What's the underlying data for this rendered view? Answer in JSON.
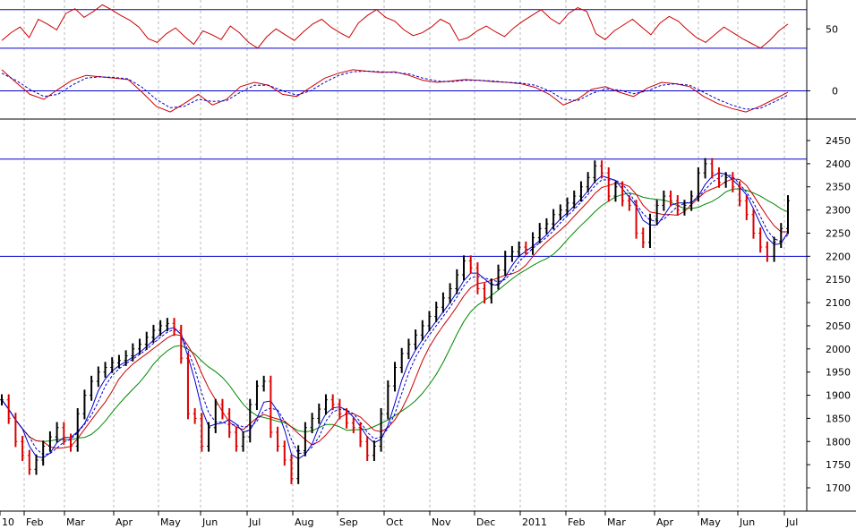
{
  "chart_data": [
    {
      "type": "line",
      "panel": "upper-oscillator",
      "y_ticks": [
        "50"
      ],
      "reference_levels": [
        70,
        30
      ],
      "points": [
        38,
        46,
        52,
        41,
        60,
        55,
        49,
        66,
        71,
        62,
        68,
        75,
        70,
        64,
        59,
        52,
        40,
        36,
        45,
        51,
        42,
        34,
        48,
        44,
        39,
        53,
        46,
        36,
        30,
        42,
        50,
        44,
        38,
        47,
        55,
        60,
        52,
        46,
        41,
        56,
        64,
        70,
        62,
        58,
        49,
        43,
        46,
        52,
        60,
        55,
        38,
        41,
        48,
        53,
        47,
        42,
        51,
        58,
        64,
        70,
        61,
        55,
        66,
        72,
        68,
        45,
        39,
        48,
        54,
        60,
        52,
        44,
        56,
        63,
        58,
        49,
        41,
        36,
        44,
        52,
        46,
        40,
        35,
        30,
        38,
        48,
        55
      ]
    },
    {
      "type": "line",
      "panel": "middle-oscillator",
      "y_ticks": [
        "0"
      ],
      "reference_levels": [
        0
      ],
      "series": [
        {
          "name": "",
          "style": "solid",
          "color": "#cc0000",
          "values": [
            30,
            12,
            -5,
            -12,
            2,
            15,
            22,
            20,
            18,
            16,
            -2,
            -22,
            -30,
            -18,
            -5,
            -20,
            -12,
            6,
            12,
            8,
            -5,
            -8,
            5,
            18,
            25,
            30,
            28,
            26,
            27,
            22,
            15,
            12,
            14,
            16,
            15,
            13,
            12,
            10,
            5,
            -5,
            -20,
            -12,
            2,
            6,
            -2,
            -8,
            4,
            12,
            10,
            6,
            -8,
            -18,
            -25,
            -30,
            -22,
            -12,
            -2
          ]
        },
        {
          "name": "",
          "style": "dashed",
          "color": "#0000cc",
          "values": [
            25,
            15,
            2,
            -8,
            -5,
            8,
            18,
            20,
            19,
            17,
            5,
            -12,
            -24,
            -22,
            -12,
            -15,
            -14,
            -2,
            8,
            8,
            0,
            -6,
            0,
            12,
            22,
            27,
            28,
            27,
            26,
            24,
            18,
            14,
            13,
            15,
            15,
            14,
            12,
            11,
            8,
            0,
            -12,
            -14,
            -4,
            3,
            1,
            -4,
            0,
            8,
            10,
            8,
            -2,
            -12,
            -20,
            -26,
            -25,
            -16,
            -6
          ]
        }
      ]
    },
    {
      "type": "line",
      "panel": "price",
      "subtype": "ohlc-bars",
      "y_ticks": [
        "2450",
        "2400",
        "2350",
        "2300",
        "2250",
        "2200",
        "2150",
        "2100",
        "2050",
        "2000",
        "1950",
        "1900",
        "1850",
        "1800",
        "1750",
        "1700"
      ],
      "ylim": [
        1680,
        2480
      ],
      "horizontal_levels": [
        2410,
        2200
      ],
      "x_ticks": [
        "10",
        "Feb",
        "Mar",
        "Apr",
        "May",
        "Jun",
        "Jul",
        "Aug",
        "Sep",
        "Oct",
        "Nov",
        "Dec",
        "2011",
        "Feb",
        "Mar",
        "Apr",
        "May",
        "Jun",
        "Jul"
      ],
      "close": [
        1890,
        1850,
        1800,
        1770,
        1740,
        1760,
        1790,
        1810,
        1830,
        1805,
        1790,
        1860,
        1900,
        1930,
        1950,
        1960,
        1970,
        1975,
        1985,
        2000,
        2010,
        2025,
        2040,
        2050,
        2055,
        2040,
        1980,
        1860,
        1850,
        1790,
        1830,
        1880,
        1860,
        1820,
        1790,
        1810,
        1880,
        1920,
        1930,
        1820,
        1790,
        1760,
        1720,
        1780,
        1830,
        1850,
        1870,
        1890,
        1880,
        1860,
        1840,
        1830,
        1800,
        1770,
        1790,
        1860,
        1920,
        1960,
        1990,
        2010,
        2030,
        2050,
        2070,
        2090,
        2110,
        2130,
        2160,
        2190,
        2175,
        2130,
        2110,
        2140,
        2170,
        2200,
        2210,
        2220,
        2215,
        2240,
        2260,
        2270,
        2290,
        2300,
        2315,
        2330,
        2350,
        2370,
        2395,
        2380,
        2330,
        2350,
        2320,
        2310,
        2250,
        2230,
        2280,
        2310,
        2330,
        2320,
        2300,
        2310,
        2330,
        2380,
        2400,
        2380,
        2360,
        2370,
        2350,
        2320,
        2290,
        2250,
        2220,
        2200,
        2230,
        2260,
        2320
      ]
    }
  ]
}
